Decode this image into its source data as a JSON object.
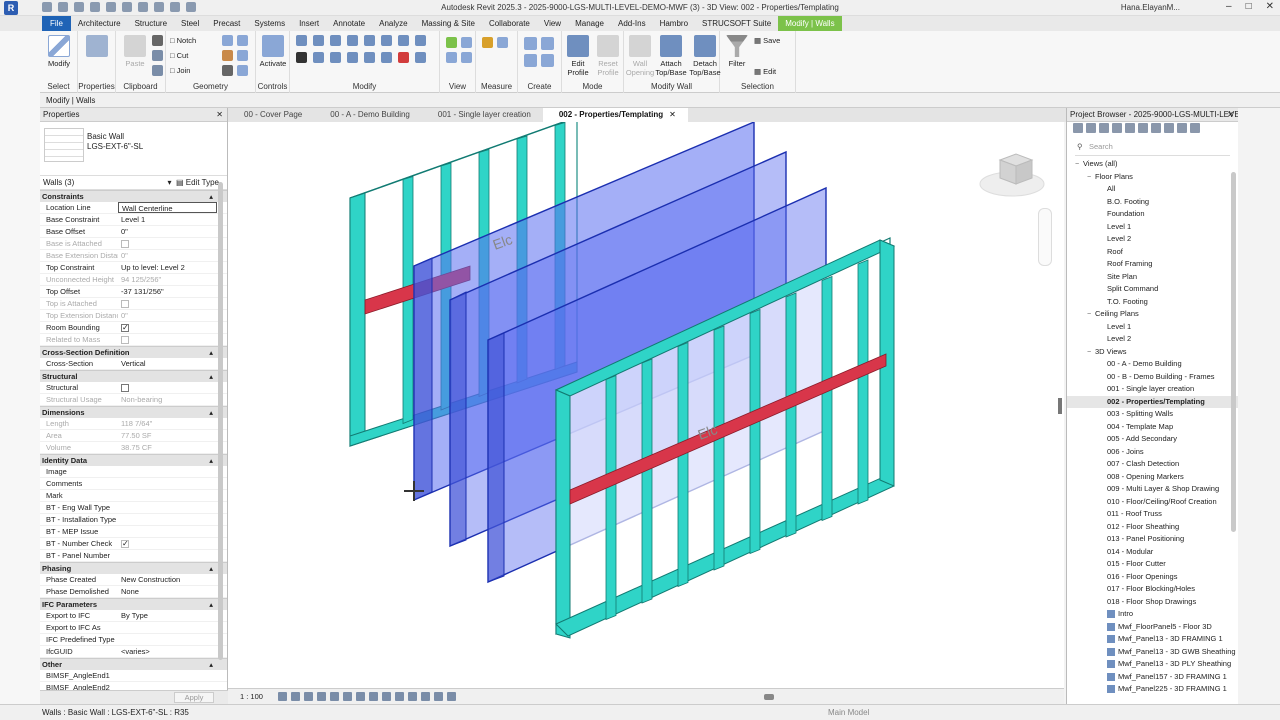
{
  "window": {
    "title": "Autodesk Revit 2025.3 - 2025-9000-LGS-MULTI-LEVEL-DEMO-MWF (3) - 3D View: 002 - Properties/Templating",
    "user": "Hana.ElayanM...",
    "app_logo": "R"
  },
  "ribbon_tabs": [
    "File",
    "Architecture",
    "Structure",
    "Steel",
    "Precast",
    "Systems",
    "Insert",
    "Annotate",
    "Analyze",
    "Massing & Site",
    "Collaborate",
    "View",
    "Manage",
    "Add-Ins",
    "Hambro",
    "STRUCSOFT Suite",
    "Modify | Walls"
  ],
  "ribbon": {
    "modify_label": "Modify",
    "select_label": "Select",
    "properties_label": "Properties",
    "clipboard_label": "Clipboard",
    "paste_label": "Paste",
    "geometry_label": "Geometry",
    "notch_label": "Notch",
    "cut_label": "Cut",
    "join_label": "Join",
    "controls_label": "Controls",
    "activate_label": "Activate",
    "modify_group_label": "Modify",
    "view_label": "View",
    "measure_label": "Measure",
    "create_label": "Create",
    "mode_label": "Mode",
    "edit_profile_label": "Edit Profile",
    "reset_profile_label": "Reset Profile",
    "wall_opening_label": "Wall Opening",
    "attach_label": "Attach Top/Base",
    "detach_label": "Detach Top/Base",
    "modify_wall_label": "Modify Wall",
    "filter_label": "Filter",
    "save_label": "Save",
    "edit_label": "Edit",
    "selection_label": "Selection"
  },
  "optbar": {
    "context": "Modify | Walls"
  },
  "properties": {
    "title": "Properties",
    "family": "Basic Wall",
    "type": "LGS-EXT-6\"-SL",
    "filter": "Walls (3)",
    "edit_type": "Edit Type",
    "apply": "Apply",
    "sections": [
      {
        "name": "Constraints",
        "rows": [
          {
            "k": "Location Line",
            "v": "Wall Centerline",
            "boxed": true
          },
          {
            "k": "Base Constraint",
            "v": "Level 1"
          },
          {
            "k": "Base Offset",
            "v": "0\""
          },
          {
            "k": "Base is Attached",
            "v": "",
            "dim": true,
            "check": "grey"
          },
          {
            "k": "Base Extension Distan...",
            "v": "0\"",
            "dim": true
          },
          {
            "k": "Top Constraint",
            "v": "Up to level: Level 2"
          },
          {
            "k": "Unconnected Height",
            "v": "94 125/256\"",
            "dim": true
          },
          {
            "k": "Top Offset",
            "v": "-37 131/256\""
          },
          {
            "k": "Top is Attached",
            "v": "",
            "dim": true,
            "check": "grey"
          },
          {
            "k": "Top Extension Distance",
            "v": "0\"",
            "dim": true
          },
          {
            "k": "Room Bounding",
            "v": "",
            "check": "on"
          },
          {
            "k": "Related to Mass",
            "v": "",
            "dim": true,
            "check": "grey"
          }
        ]
      },
      {
        "name": "Cross-Section Definition",
        "rows": [
          {
            "k": "Cross-Section",
            "v": "Vertical"
          }
        ]
      },
      {
        "name": "Structural",
        "rows": [
          {
            "k": "Structural",
            "v": "",
            "check": "off"
          },
          {
            "k": "Structural Usage",
            "v": "Non-bearing",
            "dim": true
          }
        ]
      },
      {
        "name": "Dimensions",
        "rows": [
          {
            "k": "Length",
            "v": "118 7/64\"",
            "dim": true
          },
          {
            "k": "Area",
            "v": "77.50 SF",
            "dim": true
          },
          {
            "k": "Volume",
            "v": "38.75 CF",
            "dim": true
          }
        ]
      },
      {
        "name": "Identity Data",
        "rows": [
          {
            "k": "Image",
            "v": ""
          },
          {
            "k": "Comments",
            "v": ""
          },
          {
            "k": "Mark",
            "v": ""
          },
          {
            "k": "BT - Eng Wall Type",
            "v": ""
          },
          {
            "k": "BT - Installation Type",
            "v": ""
          },
          {
            "k": "BT - MEP Issue",
            "v": ""
          },
          {
            "k": "BT - Number Check",
            "v": "",
            "check": "grey-on"
          },
          {
            "k": "BT - Panel Number",
            "v": ""
          }
        ]
      },
      {
        "name": "Phasing",
        "rows": [
          {
            "k": "Phase Created",
            "v": "New Construction"
          },
          {
            "k": "Phase Demolished",
            "v": "None"
          }
        ]
      },
      {
        "name": "IFC Parameters",
        "rows": [
          {
            "k": "Export to IFC",
            "v": "By Type"
          },
          {
            "k": "Export to IFC As",
            "v": ""
          },
          {
            "k": "IFC Predefined Type",
            "v": ""
          },
          {
            "k": "IfcGUID",
            "v": "<varies>"
          }
        ]
      },
      {
        "name": "Other",
        "rows": [
          {
            "k": "BIMSF_AngleEnd1",
            "v": ""
          },
          {
            "k": "BIMSF_AngleEnd2",
            "v": ""
          }
        ]
      }
    ]
  },
  "view_tabs": [
    {
      "label": "00 - Cover Page",
      "active": false
    },
    {
      "label": "00 - A - Demo Building",
      "active": false
    },
    {
      "label": "001 - Single layer creation",
      "active": false
    },
    {
      "label": "002 - Properties/Templating",
      "active": true
    }
  ],
  "viewbar": {
    "scale": "1 : 100"
  },
  "project_browser": {
    "title": "Project Browser - 2025-9000-LGS-MULTI-LEVE...",
    "search_placeholder": "Search",
    "tree": [
      {
        "label": "Views (all)",
        "level": 0,
        "tw": "−"
      },
      {
        "label": "Floor Plans",
        "level": 1,
        "tw": "−"
      },
      {
        "label": "All",
        "level": 2
      },
      {
        "label": "B.O. Footing",
        "level": 2
      },
      {
        "label": "Foundation",
        "level": 2
      },
      {
        "label": "Level 1",
        "level": 2
      },
      {
        "label": "Level 2",
        "level": 2
      },
      {
        "label": "Roof",
        "level": 2
      },
      {
        "label": "Roof Framing",
        "level": 2
      },
      {
        "label": "Site Plan",
        "level": 2
      },
      {
        "label": "Split Command",
        "level": 2
      },
      {
        "label": "T.O. Footing",
        "level": 2
      },
      {
        "label": "Ceiling Plans",
        "level": 1,
        "tw": "−"
      },
      {
        "label": "Level 1",
        "level": 2
      },
      {
        "label": "Level 2",
        "level": 2
      },
      {
        "label": "3D Views",
        "level": 1,
        "tw": "−"
      },
      {
        "label": "00 - A - Demo Building",
        "level": 2
      },
      {
        "label": "00 - B - Demo Building - Frames",
        "level": 2
      },
      {
        "label": "001 - Single layer creation",
        "level": 2
      },
      {
        "label": "002 - Properties/Templating",
        "level": 2,
        "bold": true
      },
      {
        "label": "003 - Splitting Walls",
        "level": 2
      },
      {
        "label": "004 - Template Map",
        "level": 2
      },
      {
        "label": "005 - Add Secondary",
        "level": 2
      },
      {
        "label": "006 - Joins",
        "level": 2
      },
      {
        "label": "007 - Clash Detection",
        "level": 2
      },
      {
        "label": "008 - Opening Markers",
        "level": 2
      },
      {
        "label": "009 - Multi Layer & Shop Drawing",
        "level": 2
      },
      {
        "label": "010 - Floor/Ceiling/Roof Creation",
        "level": 2
      },
      {
        "label": "011 - Roof Truss",
        "level": 2
      },
      {
        "label": "012 - Floor Sheathing",
        "level": 2
      },
      {
        "label": "013 - Panel Positioning",
        "level": 2
      },
      {
        "label": "014 - Modular",
        "level": 2
      },
      {
        "label": "015 - Floor Cutter",
        "level": 2
      },
      {
        "label": "016 - Floor Openings",
        "level": 2
      },
      {
        "label": "017 - Floor Blocking/Holes",
        "level": 2
      },
      {
        "label": "018 - Floor Shop Drawings",
        "level": 2
      },
      {
        "label": "Intro",
        "level": 2,
        "icon": true
      },
      {
        "label": "Mwf_FloorPanel5 - Floor 3D",
        "level": 2,
        "icon": true
      },
      {
        "label": "Mwf_Panel13 - 3D FRAMING 1",
        "level": 2,
        "icon": true
      },
      {
        "label": "Mwf_Panel13 - 3D GWB Sheathing",
        "level": 2,
        "icon": true
      },
      {
        "label": "Mwf_Panel13 - 3D PLY Sheathing",
        "level": 2,
        "icon": true
      },
      {
        "label": "Mwf_Panel157 - 3D FRAMING 1",
        "level": 2,
        "icon": true
      },
      {
        "label": "Mwf_Panel225 - 3D FRAMING 1",
        "level": 2,
        "icon": true
      }
    ]
  },
  "status": {
    "text": "Walls : Basic Wall : LGS-EXT-6\"-SL : R35",
    "model": "Main Model"
  },
  "colors": {
    "file_tab": "#1f63b6",
    "context_tab": "#7cc24a",
    "stud_teal": "#2fd4c7",
    "sheathing_blue": "#4a5fd8",
    "blocking_red": "#d8364a"
  }
}
